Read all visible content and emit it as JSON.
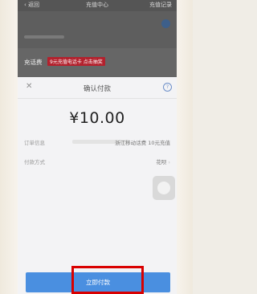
{
  "header": {
    "back_label": "返回",
    "title": "充值中心",
    "right_label": "充值记录"
  },
  "recharge": {
    "fee_label": "充话费",
    "promo_tag": "9元充值电话卡 点击抽奖"
  },
  "sheet": {
    "close_icon": "close-icon",
    "title": "确认付款",
    "help_icon": "question-icon",
    "amount": "¥10.00",
    "order_label": "订单信息",
    "order_value": "浙江移动话费 10元充值",
    "pay_method_label": "付款方式",
    "pay_method_value": "花呗"
  },
  "pay_button": {
    "label": "立即付款"
  },
  "colors": {
    "accent": "#4a8fe0",
    "highlight": "#d90000",
    "promo": "#b3212d"
  }
}
